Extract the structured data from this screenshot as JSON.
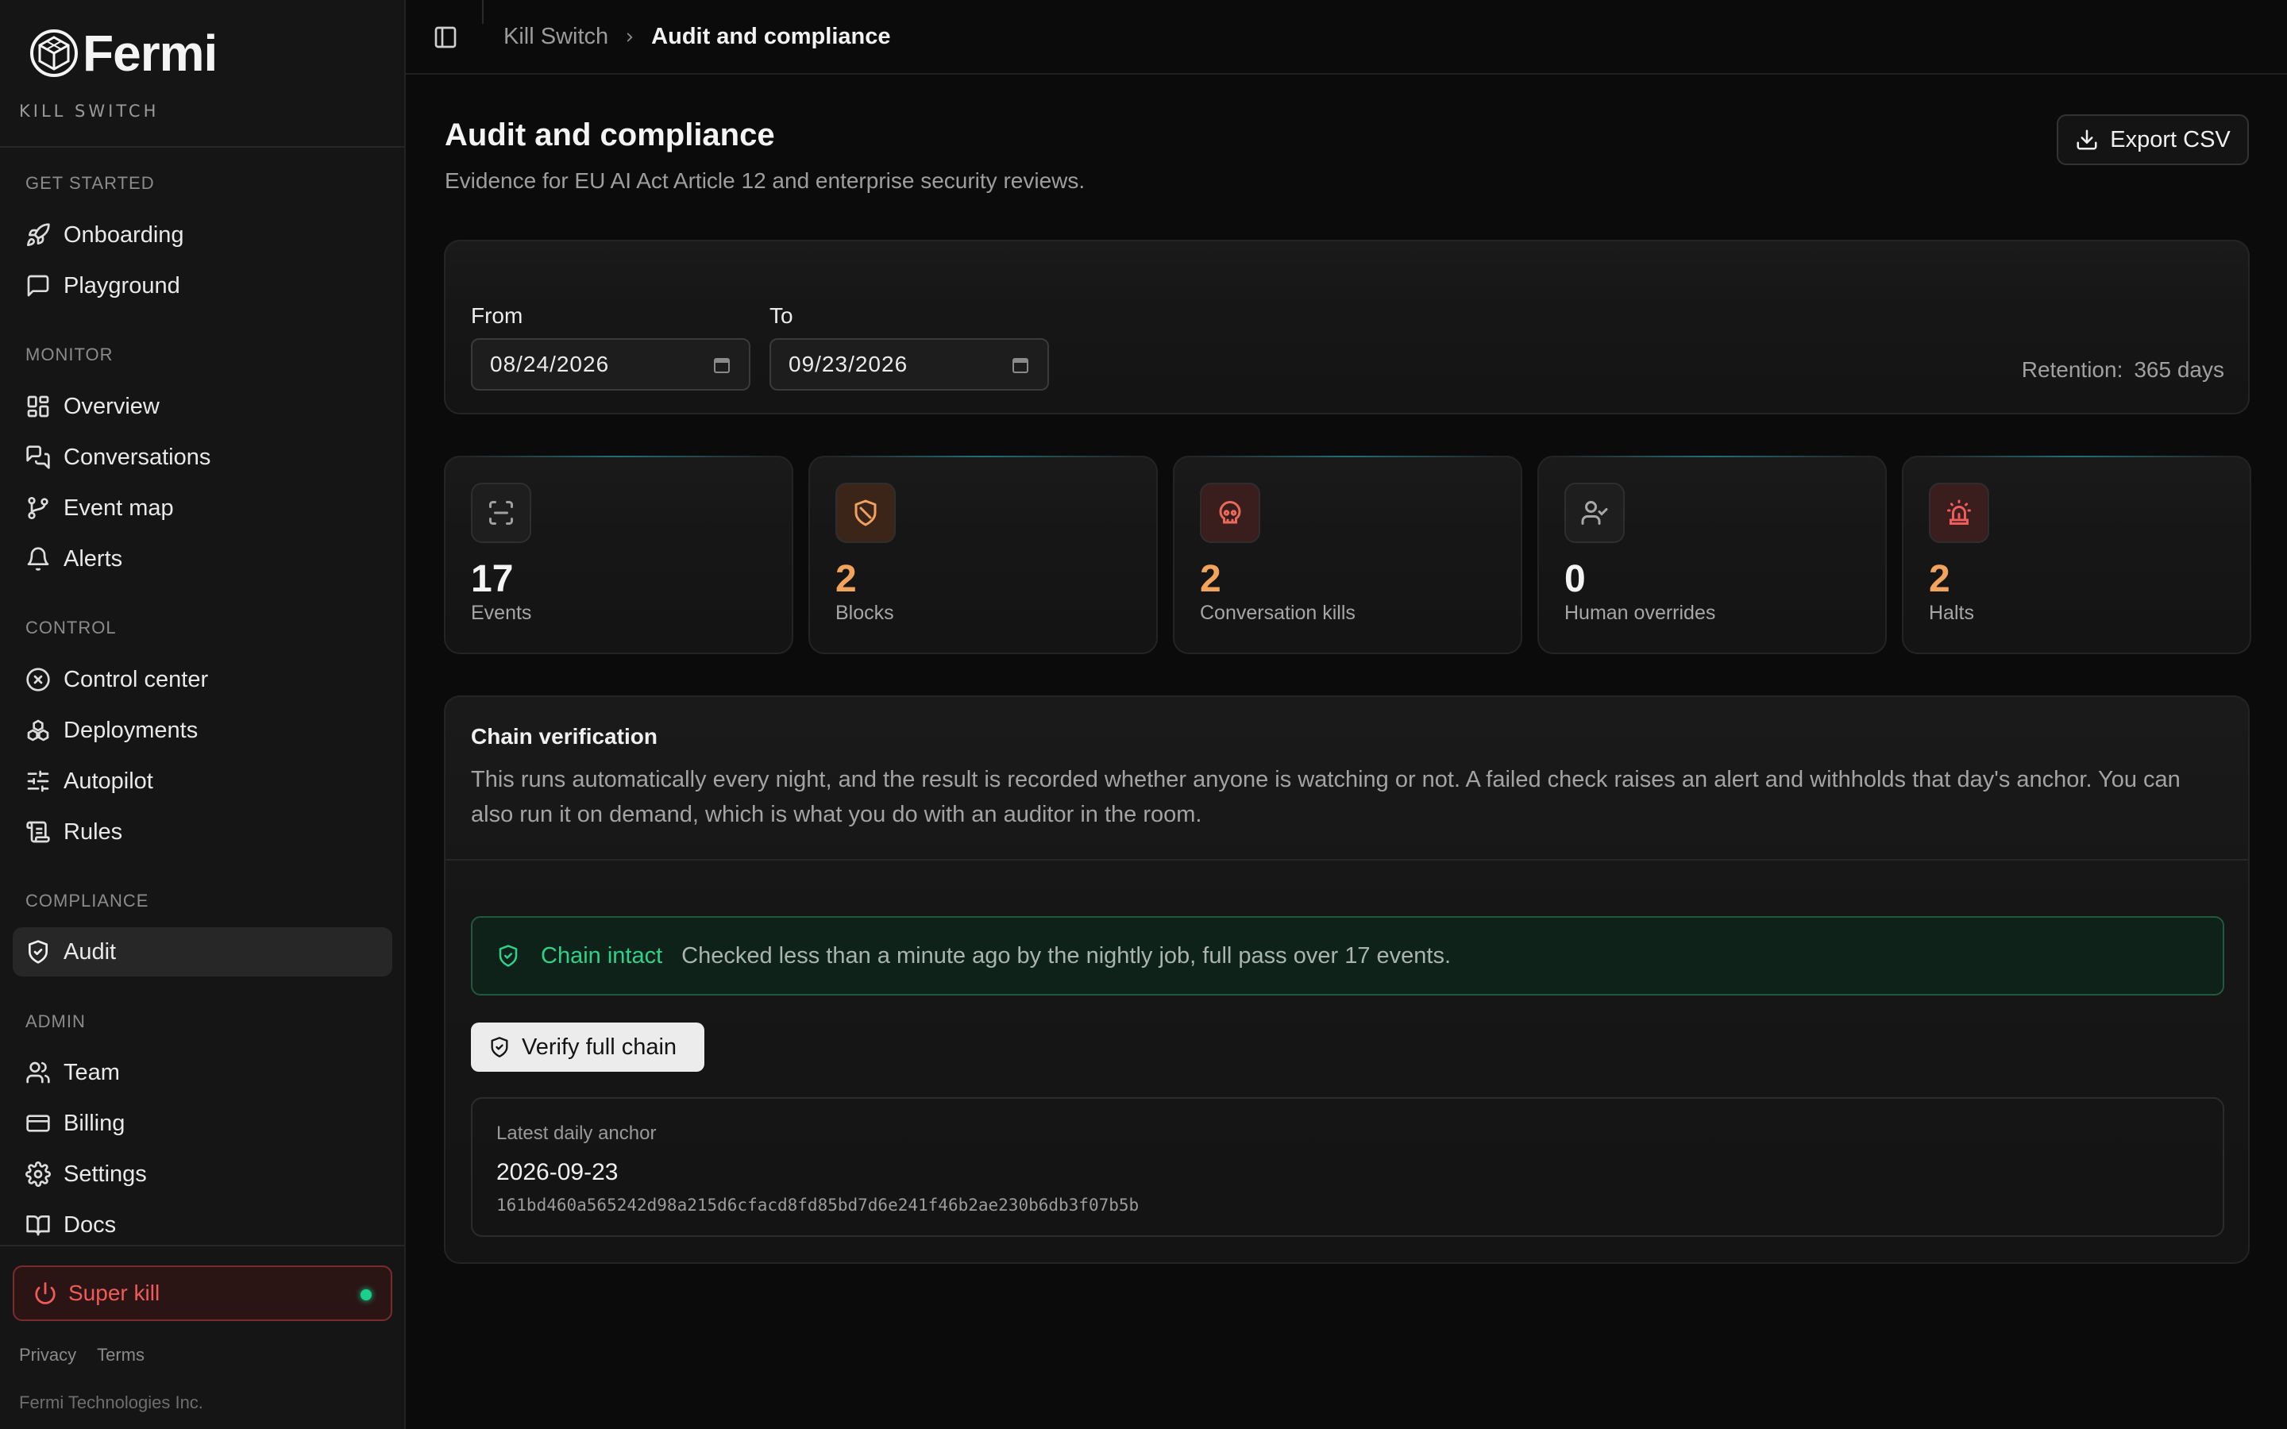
{
  "brand": {
    "name": "Fermi",
    "product": "KILL SWITCH"
  },
  "sidebar": {
    "sections": [
      {
        "label": "GET STARTED",
        "items": [
          {
            "label": "Onboarding",
            "icon": "rocket-icon"
          },
          {
            "label": "Playground",
            "icon": "message-square-icon"
          }
        ]
      },
      {
        "label": "MONITOR",
        "items": [
          {
            "label": "Overview",
            "icon": "dashboard-icon"
          },
          {
            "label": "Conversations",
            "icon": "messages-icon"
          },
          {
            "label": "Event map",
            "icon": "git-branch-icon"
          },
          {
            "label": "Alerts",
            "icon": "bell-icon"
          }
        ]
      },
      {
        "label": "CONTROL",
        "items": [
          {
            "label": "Control center",
            "icon": "x-circle-icon"
          },
          {
            "label": "Deployments",
            "icon": "boxes-icon"
          },
          {
            "label": "Autopilot",
            "icon": "sliders-icon"
          },
          {
            "label": "Rules",
            "icon": "scroll-icon"
          }
        ]
      },
      {
        "label": "COMPLIANCE",
        "items": [
          {
            "label": "Audit",
            "icon": "shield-check-icon",
            "active": true
          }
        ]
      },
      {
        "label": "ADMIN",
        "items": [
          {
            "label": "Team",
            "icon": "users-icon"
          },
          {
            "label": "Billing",
            "icon": "credit-card-icon"
          },
          {
            "label": "Settings",
            "icon": "gear-icon"
          },
          {
            "label": "Docs",
            "icon": "book-icon"
          }
        ]
      }
    ],
    "superkill_label": "Super kill",
    "footer": {
      "privacy": "Privacy",
      "terms": "Terms",
      "copyright": "Fermi Technologies Inc."
    }
  },
  "breadcrumb": {
    "parent": "Kill Switch",
    "current": "Audit and compliance"
  },
  "page": {
    "title": "Audit and compliance",
    "subtitle": "Evidence for EU AI Act Article 12 and enterprise security reviews.",
    "export_label": "Export CSV"
  },
  "filters": {
    "from_label": "From",
    "from_value": "08/24/2026",
    "to_label": "To",
    "to_value": "09/23/2026",
    "retention_label": "Retention:",
    "retention_value": "365 days"
  },
  "stats": [
    {
      "value": "17",
      "label": "Events",
      "icon": "scan-icon",
      "color": "#f4f4f4",
      "icon_color": "#a0a0a0",
      "box_bg": "#1e1e1e"
    },
    {
      "value": "2",
      "label": "Blocks",
      "icon": "shield-off-icon",
      "color": "#f2a35c",
      "icon_color": "#f0a060",
      "box_bg": "#3a2518"
    },
    {
      "value": "2",
      "label": "Conversation kills",
      "icon": "skull-icon",
      "color": "#f2a35c",
      "icon_color": "#e86a5a",
      "box_bg": "#3a1d1d"
    },
    {
      "value": "0",
      "label": "Human overrides",
      "icon": "user-check-icon",
      "color": "#f4f4f4",
      "icon_color": "#a8a8a8",
      "box_bg": "#1e1e1e"
    },
    {
      "value": "2",
      "label": "Halts",
      "icon": "siren-icon",
      "color": "#f2a35c",
      "icon_color": "#ee5c5c",
      "box_bg": "#3a1d1d"
    }
  ],
  "chain": {
    "title": "Chain verification",
    "description": "This runs automatically every night, and the result is recorded whether anyone is watching or not. A failed check raises an alert and withholds that day's anchor. You can also run it on demand, which is what you do with an auditor in the room.",
    "status_label": "Chain intact",
    "status_text": "Checked less than a minute ago by the nightly job, full pass over 17 events.",
    "verify_label": "Verify full chain",
    "anchor_label": "Latest daily anchor",
    "anchor_date": "2026-09-23",
    "anchor_hash": "161bd460a565242d98a215d6cfacd8fd85bd7d6e241f46b2ae230b6db3f07b5b"
  },
  "colors": {
    "accent_green": "#2fd08a",
    "danger": "#ef5a5a",
    "warning": "#f2a35c"
  }
}
